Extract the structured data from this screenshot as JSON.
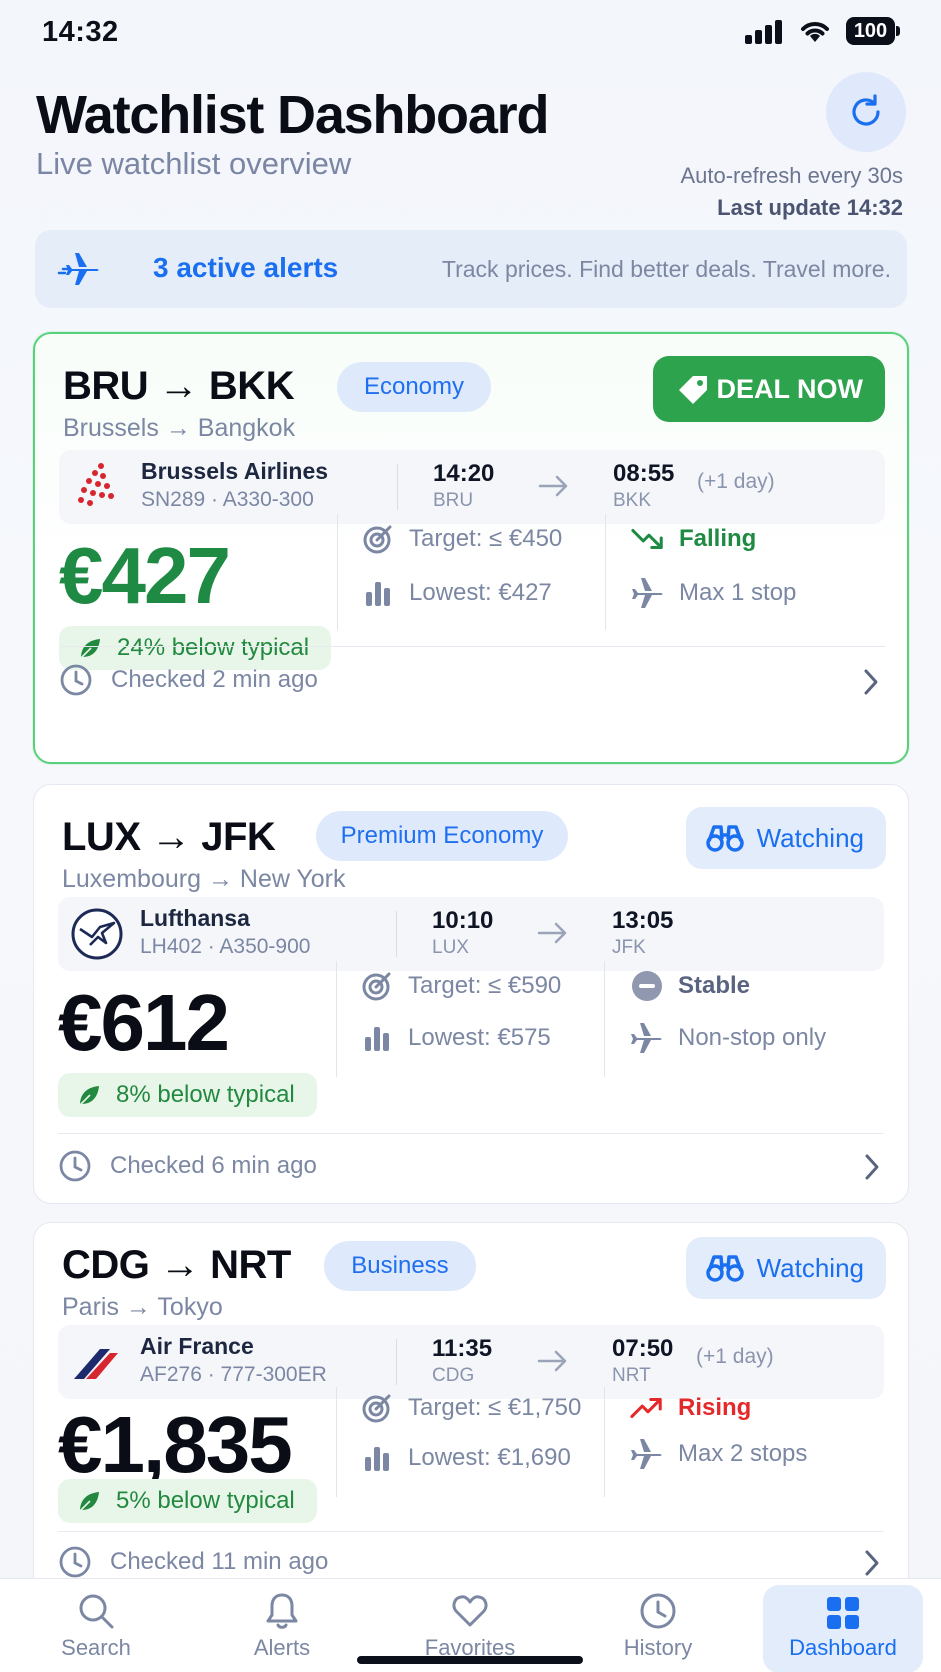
{
  "status_bar": {
    "time": "14:32",
    "battery": "100"
  },
  "header": {
    "title": "Watchlist Dashboard",
    "subtitle": "Live watchlist overview",
    "auto_refresh": "Auto-refresh every 30s",
    "last_update": "Last update 14:32"
  },
  "alerts_banner": {
    "count_label": "3 active alerts",
    "tagline": "Track prices. Find better deals. Travel more."
  },
  "cards": [
    {
      "from": "BRU",
      "to": "BKK",
      "from_city": "Brussels",
      "to_city": "Bangkok",
      "cabin": "Economy",
      "status_button": "DEAL NOW",
      "airline": "Brussels Airlines",
      "flight": "SN289 · A330-300",
      "dep_time": "14:20",
      "dep_code": "BRU",
      "arr_time": "08:55",
      "arr_code": "BKK",
      "day_note": "(+1 day)",
      "price": "€427",
      "below_typical": "24% below typical",
      "target": "Target: ≤ €450",
      "lowest": "Lowest: €427",
      "trend": "Falling",
      "stops": "Max 1 stop",
      "checked": "Checked 2 min ago"
    },
    {
      "from": "LUX",
      "to": "JFK",
      "from_city": "Luxembourg",
      "to_city": "New York",
      "cabin": "Premium Economy",
      "status_button": "Watching",
      "airline": "Lufthansa",
      "flight": "LH402 · A350-900",
      "dep_time": "10:10",
      "dep_code": "LUX",
      "arr_time": "13:05",
      "arr_code": "JFK",
      "day_note": "",
      "price": "€612",
      "below_typical": "8% below typical",
      "target": "Target: ≤ €590",
      "lowest": "Lowest: €575",
      "trend": "Stable",
      "stops": "Non-stop only",
      "checked": "Checked 6 min ago"
    },
    {
      "from": "CDG",
      "to": "NRT",
      "from_city": "Paris",
      "to_city": "Tokyo",
      "cabin": "Business",
      "status_button": "Watching",
      "airline": "Air France",
      "flight": "AF276 · 777-300ER",
      "dep_time": "11:35",
      "dep_code": "CDG",
      "arr_time": "07:50",
      "arr_code": "NRT",
      "day_note": "(+1 day)",
      "price": "€1,835",
      "below_typical": "5% below typical",
      "target": "Target: ≤ €1,750",
      "lowest": "Lowest: €1,690",
      "trend": "Rising",
      "stops": "Max 2 stops",
      "checked": "Checked 11 min ago"
    }
  ],
  "tab_bar": {
    "tabs": [
      {
        "label": "Search",
        "icon": "search-icon"
      },
      {
        "label": "Alerts",
        "icon": "bell-icon"
      },
      {
        "label": "Favorites",
        "icon": "heart-icon"
      },
      {
        "label": "History",
        "icon": "clock-icon"
      },
      {
        "label": "Dashboard",
        "icon": "grid-icon"
      }
    ],
    "active": "Dashboard"
  },
  "colors": {
    "accent_blue": "#1a6ff0",
    "deal_green": "#2da34d",
    "falling_green": "#1e8a43",
    "rising_red": "#e5292b"
  }
}
